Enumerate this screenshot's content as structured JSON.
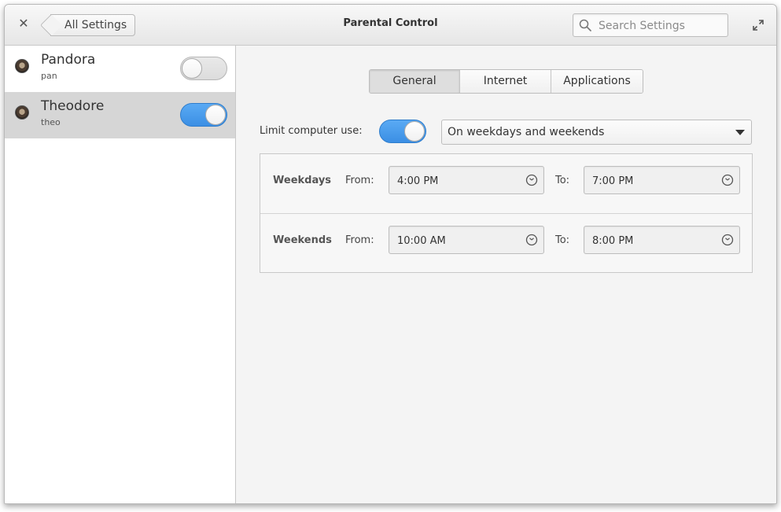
{
  "titlebar": {
    "title": "Parental Control",
    "back_label": "All Settings",
    "search_placeholder": "Search Settings",
    "close_icon": "close-icon",
    "maximize_icon": "maximize-icon"
  },
  "users": [
    {
      "name": "Pandora",
      "login": "pan",
      "enabled": false,
      "selected": false
    },
    {
      "name": "Theodore",
      "login": "theo",
      "enabled": true,
      "selected": true
    }
  ],
  "tabs": [
    {
      "label": "General",
      "active": true
    },
    {
      "label": "Internet",
      "active": false
    },
    {
      "label": "Applications",
      "active": false
    }
  ],
  "limit": {
    "label": "Limit computer use:",
    "enabled": true,
    "selected_option": "On weekdays and weekends"
  },
  "schedule": [
    {
      "day": "Weekdays",
      "from_label": "From:",
      "from": "4:00 PM",
      "to_label": "To:",
      "to": "7:00 PM"
    },
    {
      "day": "Weekends",
      "from_label": "From:",
      "from": "10:00 AM",
      "to_label": "To:",
      "to": "8:00 PM"
    }
  ],
  "colors": {
    "accent": "#3b8fe4",
    "selected_row": "#d6d6d6"
  }
}
